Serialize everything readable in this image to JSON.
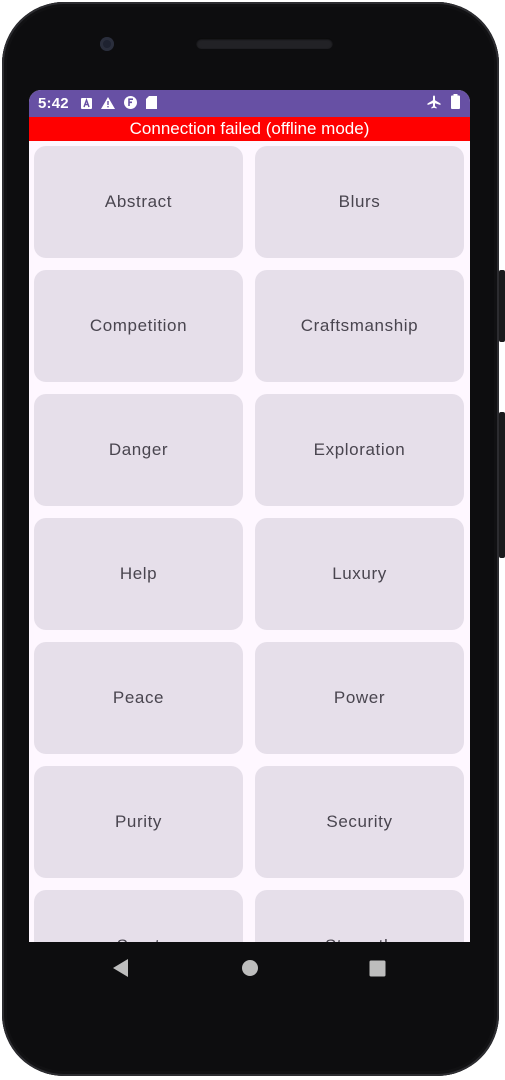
{
  "status_bar": {
    "time": "5:42",
    "left_icons": [
      "keyboard-a-icon",
      "warning-icon",
      "f-badge-icon",
      "sd-card-icon"
    ],
    "right_icons": [
      "airplane-mode-icon",
      "battery-icon"
    ],
    "color": "#6750a4"
  },
  "banner": {
    "text": "Connection failed (offline mode)",
    "color": "#ff0000"
  },
  "categories": [
    "Abstract",
    "Blurs",
    "Competition",
    "Craftsmanship",
    "Danger",
    "Exploration",
    "Help",
    "Luxury",
    "Peace",
    "Power",
    "Purity",
    "Security",
    "Sport",
    "Strength"
  ],
  "nav_bar": {
    "buttons": [
      "back-icon",
      "home-icon",
      "recents-icon"
    ]
  },
  "colors": {
    "background": "#fef7ff",
    "tile": "#e6dfea",
    "tile_text": "#49454f"
  }
}
